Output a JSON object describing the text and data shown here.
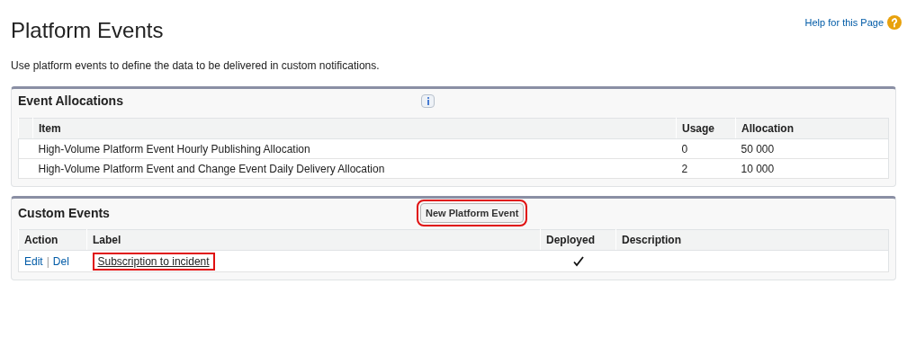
{
  "page": {
    "title": "Platform Events",
    "help_link": "Help for this Page",
    "description": "Use platform events to define the data to be delivered in custom notifications."
  },
  "event_allocations": {
    "title": "Event Allocations",
    "columns": [
      "Item",
      "Usage",
      "Allocation"
    ],
    "rows": [
      {
        "item": "High-Volume Platform Event Hourly Publishing Allocation",
        "usage": "0",
        "allocation": "50 000"
      },
      {
        "item": "High-Volume Platform Event and Change Event Daily Delivery Allocation",
        "usage": "2",
        "allocation": "10 000"
      }
    ]
  },
  "custom_events": {
    "title": "Custom Events",
    "new_button": {
      "label": "New Platform Event",
      "highlighted": true
    },
    "columns": [
      "Action",
      "Label",
      "Deployed",
      "Description"
    ],
    "rows": [
      {
        "actions": [
          "Edit",
          "Del"
        ],
        "action_separator": "|",
        "label": "Subscription to incident",
        "label_highlighted": true,
        "deployed": true
      }
    ]
  }
}
